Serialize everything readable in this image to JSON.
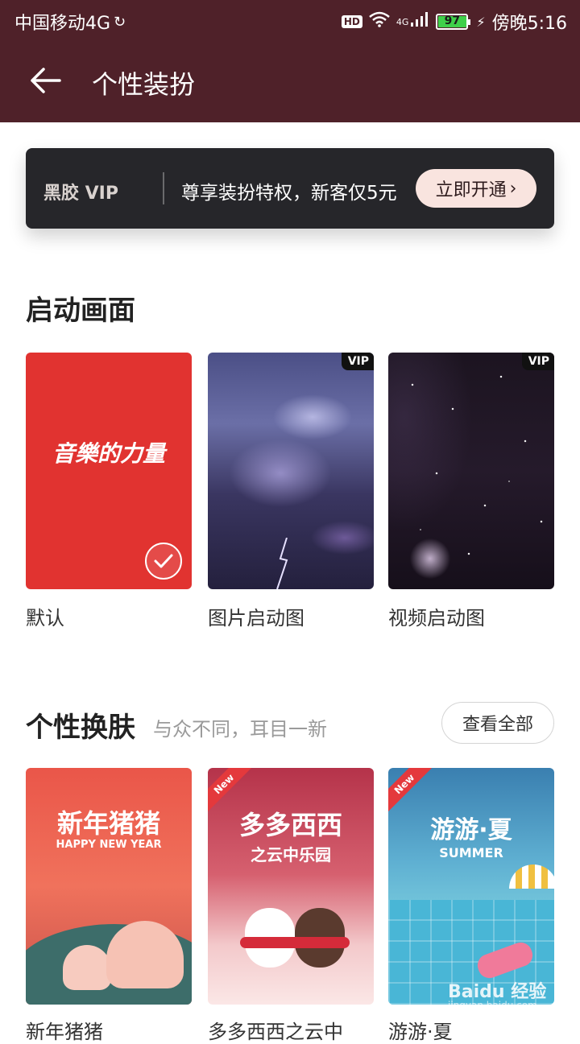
{
  "status_bar": {
    "carrier": "中国移动4G",
    "hd": "HD",
    "network": "4G",
    "battery": "97",
    "time": "傍晚5:16"
  },
  "app_bar": {
    "title": "个性装扮",
    "back_icon": "arrow-left-icon"
  },
  "vip_banner": {
    "logo": "黑胶 VIP",
    "text": "尊享装扮特权，新客仅5元",
    "button": "立即开通"
  },
  "splash_section": {
    "title": "启动画面",
    "items": [
      {
        "caption": "默认",
        "brand": "音樂的力量",
        "selected": true
      },
      {
        "caption": "图片启动图",
        "tag": "VIP"
      },
      {
        "caption": "视频启动图",
        "tag": "VIP"
      }
    ]
  },
  "skin_section": {
    "title": "个性换肤",
    "subtitle": "与众不同，耳目一新",
    "view_all": "查看全部",
    "items": [
      {
        "caption": "新年猪猪",
        "art_title": "新年猪猪",
        "art_sub": "HAPPY NEW YEAR"
      },
      {
        "caption": "多多西西之云中",
        "art_title": "多多西西",
        "art_sub": "之云中乐园",
        "badge": "New"
      },
      {
        "caption": "游游·夏",
        "art_title": "游游·夏",
        "art_sub": "SUMMER",
        "badge": "New"
      }
    ]
  },
  "watermark": {
    "brand": "Baidu 经验",
    "url": "jingyan.baidu.com"
  },
  "colors": {
    "header": "#4f2129",
    "vip_button": "#f9e4df",
    "default_splash": "#e13330"
  }
}
